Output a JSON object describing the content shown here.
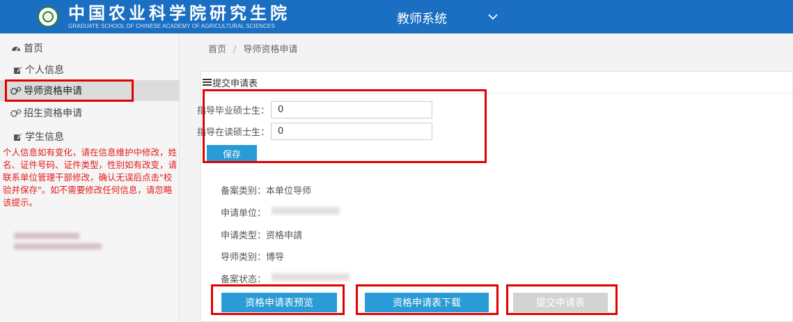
{
  "header": {
    "brand_cn": "中国农业科学院研究生院",
    "brand_en": "GRADUATE SCHOOL OF CHINESE ACADEMY OF AGRICULTURAL SCIENCES",
    "system_title": "教师系统",
    "background": "#1b6fc2"
  },
  "sidebar": {
    "items": [
      {
        "label": "首页",
        "icon": "dashboard-icon"
      },
      {
        "label": "个人信息",
        "icon": "edit-icon"
      },
      {
        "label": "导师资格申请",
        "icon": "gears-icon"
      },
      {
        "label": "招生资格申请",
        "icon": "gears-icon"
      },
      {
        "label": "学生信息",
        "icon": "edit-icon"
      }
    ],
    "active_index": 2,
    "notice": "个人信息如有变化，请在信息维护中修改，姓名、证件号码、证件类型，性别如有改变，请联系单位管理干部修改，确认无误后点击\"校验并保存\"。如不需要修改任何信息，请忽略该提示。"
  },
  "breadcrumb": {
    "home": "首页",
    "separator": "/",
    "current": "导师资格申请"
  },
  "panel": {
    "title": "提交申请表",
    "form": {
      "graduated_label": "指导毕业硕士生：",
      "graduated_value": "0",
      "enrolled_label": "指导在读硕士生：",
      "enrolled_value": "0",
      "save_label": "保存"
    },
    "info": {
      "record_type": "备案类别：本单位导师",
      "unit": "申请单位：",
      "apply_type": "申请类型：资格申請",
      "tutor_type": "导师类别：博导",
      "record_status": "备案状态："
    },
    "buttons": {
      "preview": "资格申请表预览",
      "download": "资格申请表下载",
      "submit": "提交申请表"
    }
  },
  "colors": {
    "primary_button": "#2a9bd6",
    "disabled_button": "#d3d3d3",
    "highlight_box": "#e10000",
    "notice_text": "#e41b1b"
  }
}
